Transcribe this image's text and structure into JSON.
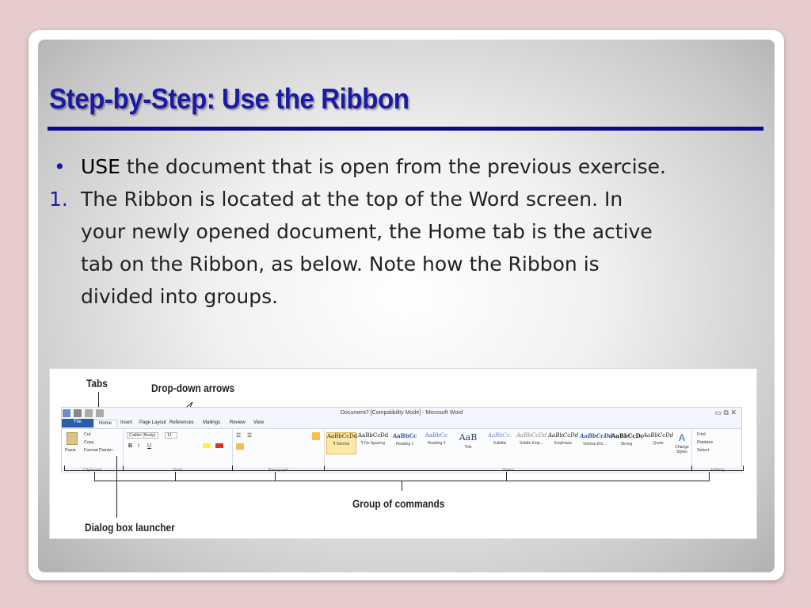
{
  "slide": {
    "title": "Step-by-Step: Use the Ribbon",
    "bullet1": {
      "keyword": "USE",
      "text": " the document that is open from the previous exercise."
    },
    "step1": {
      "num": "1.",
      "line1": "The Ribbon is located at the top of the Word screen. In",
      "line2": "your newly opened document, the Home tab is the active",
      "line3": "tab on the Ribbon, as below. Note how the Ribbon is",
      "line4": "divided into groups."
    }
  },
  "figure": {
    "annotations": {
      "tabs": "Tabs",
      "dropdowns": "Drop-down arrows",
      "group": "Group of commands",
      "launcher": "Dialog box launcher"
    },
    "window": {
      "title": "Document7 [Compatibility Mode] - Microsoft Word",
      "tabs": [
        "File",
        "Home",
        "Insert",
        "Page Layout",
        "References",
        "Mailings",
        "Review",
        "View"
      ],
      "clipboard": {
        "paste": "Paste",
        "cut": "Cut",
        "copy": "Copy",
        "painter": "Format Painter",
        "label": "Clipboard"
      },
      "font": {
        "name": "Calibri (Body)",
        "size": "11",
        "label": "Font"
      },
      "paragraph": {
        "label": "Paragraph"
      },
      "styles": {
        "label": "Styles",
        "items": [
          {
            "preview": "AaBbCcDd",
            "name": "¶ Normal"
          },
          {
            "preview": "AaBbCcDd",
            "name": "¶ No Spacing"
          },
          {
            "preview": "AaBbCc",
            "name": "Heading 1"
          },
          {
            "preview": "AaBbCc",
            "name": "Heading 2"
          },
          {
            "preview": "AaB",
            "name": "Title"
          },
          {
            "preview": "AaBbCc.",
            "name": "Subtitle"
          },
          {
            "preview": "AaBbCcDd",
            "name": "Subtle Emp..."
          },
          {
            "preview": "AaBbCcDd",
            "name": "Emphasis"
          },
          {
            "preview": "AaBbCcDd",
            "name": "Intense Em..."
          },
          {
            "preview": "AaBbCcDc",
            "name": "Strong"
          },
          {
            "preview": "AaBbCcDd",
            "name": "Quote"
          }
        ],
        "change": "Change Styles"
      },
      "editing": {
        "find": "Find",
        "replace": "Replace",
        "select": "Select",
        "label": "Editing"
      }
    }
  }
}
